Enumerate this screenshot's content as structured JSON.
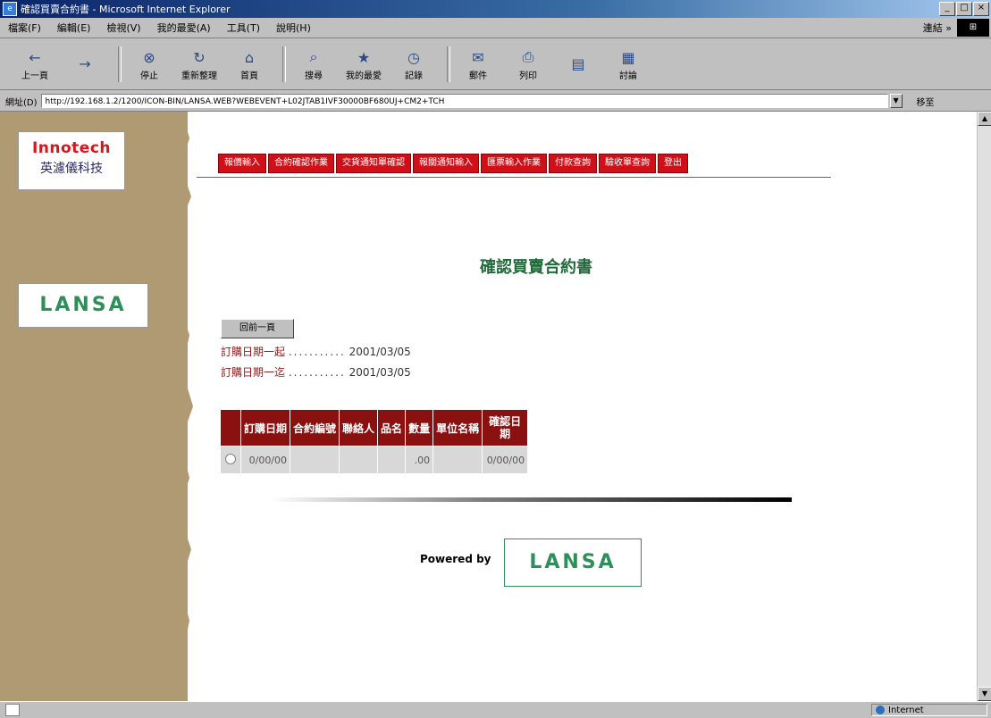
{
  "window": {
    "title": "確認買賣合約書 - Microsoft Internet Explorer",
    "controls": [
      "_",
      "□",
      "×"
    ]
  },
  "menu": {
    "items": [
      "檔案(F)",
      "編輯(E)",
      "檢視(V)",
      "我的最愛(A)",
      "工具(T)",
      "說明(H)"
    ],
    "links_label": "連結 »"
  },
  "toolbar": {
    "buttons": [
      {
        "label": "上一頁",
        "icon": "back-arrow-icon"
      },
      {
        "label": "",
        "icon": "forward-arrow-icon"
      },
      {
        "label": "停止",
        "icon": "stop-icon"
      },
      {
        "label": "重新整理",
        "icon": "refresh-icon"
      },
      {
        "label": "首頁",
        "icon": "home-icon"
      },
      {
        "label": "搜尋",
        "icon": "search-icon"
      },
      {
        "label": "我的最愛",
        "icon": "favorites-icon"
      },
      {
        "label": "記錄",
        "icon": "history-icon"
      },
      {
        "label": "郵件",
        "icon": "mail-icon"
      },
      {
        "label": "列印",
        "icon": "print-icon"
      },
      {
        "label": "",
        "icon": "edit-icon"
      },
      {
        "label": "討論",
        "icon": "discuss-icon"
      }
    ]
  },
  "address": {
    "label": "網址(D)",
    "url": "http://192.168.1.2/1200/ICON-BIN/LANSA.WEB?WEBEVENT+L02JTAB1IVF30000BF680UJ+CM2+TCH",
    "go_label": "移至"
  },
  "sidebar": {
    "logo1_brand": "Innotech",
    "logo1_sub": "英濾儀科技",
    "logo2": "LANSA"
  },
  "nav": {
    "tabs": [
      "報價輸入",
      "合約確認作業",
      "交貨通知單確認",
      "報關通知輸入",
      "匯票輸入作業",
      "付款查詢",
      "驗收單查詢",
      "登出"
    ]
  },
  "page": {
    "title": "確認買賣合約書",
    "back_button": "回前一頁",
    "date_from_label": "訂購日期一起",
    "date_from_dots": "...........",
    "date_from_value": "2001/03/05",
    "date_to_label": "訂購日期一迄",
    "date_to_dots": "...........",
    "date_to_value": "2001/03/05"
  },
  "table": {
    "headers": [
      "",
      "訂購日期",
      "合約編號",
      "聯絡人",
      "品名",
      "數量",
      "單位名稱",
      "確認日期"
    ],
    "rows": [
      {
        "order_date": "0/00/00",
        "contract_no": "",
        "contact": "",
        "product": "",
        "quantity": ".00",
        "unit": "",
        "confirm_date": "0/00/00"
      }
    ]
  },
  "footer": {
    "powered_by": "Powered by",
    "logo": "LANSA"
  },
  "status": {
    "text": "",
    "zone": "Internet"
  }
}
